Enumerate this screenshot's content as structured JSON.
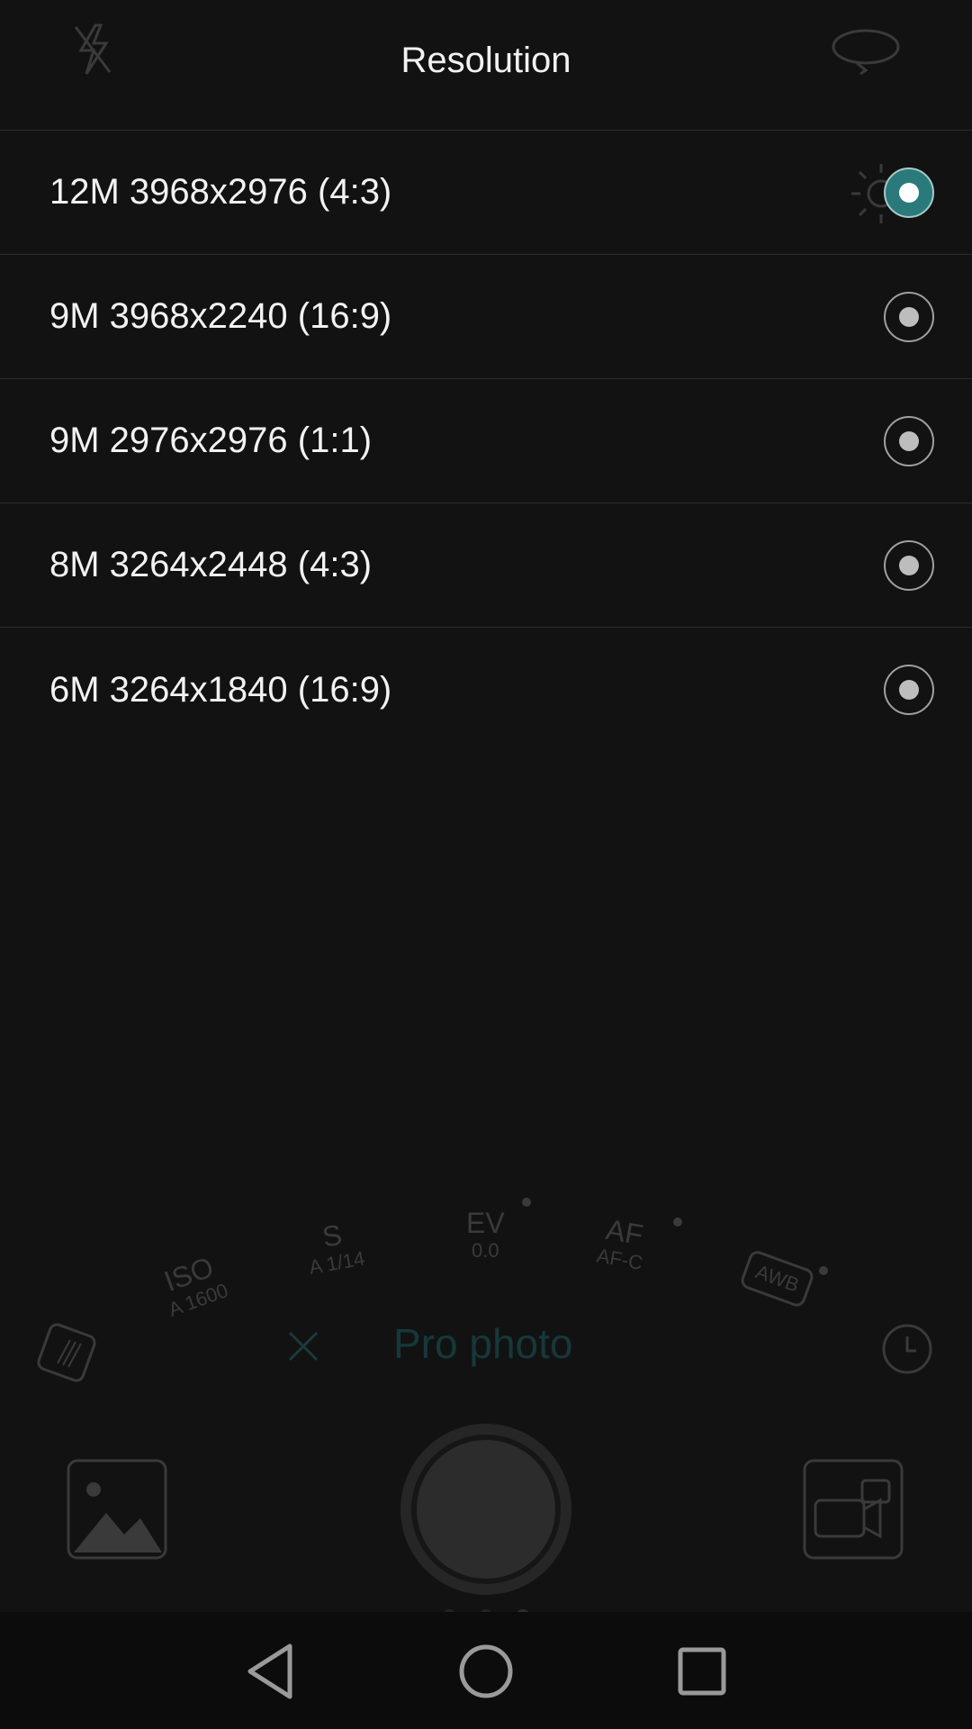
{
  "header": {
    "title": "Resolution"
  },
  "resolutions": [
    {
      "label": "12M 3968x2976 (4:3)",
      "selected": true
    },
    {
      "label": "9M 3968x2240 (16:9)",
      "selected": false
    },
    {
      "label": "9M 2976x2976 (1:1)",
      "selected": false
    },
    {
      "label": "8M 3264x2448 (4:3)",
      "selected": false
    },
    {
      "label": "6M 3264x1840 (16:9)",
      "selected": false
    }
  ],
  "camera": {
    "mode_label": "Pro photo",
    "dials": {
      "iso": {
        "name": "ISO",
        "value": "A 1600"
      },
      "shutter": {
        "name": "S",
        "value": "A 1/14"
      },
      "ev": {
        "name": "EV",
        "value": "0.0"
      },
      "af": {
        "name": "AF",
        "value": "AF-C"
      },
      "awb": {
        "name": "AWB"
      }
    }
  },
  "colors": {
    "accent": "#2a7a7c",
    "background": "#121212"
  },
  "icons": [
    "flash-off-icon",
    "switch-camera-icon",
    "brightness-icon",
    "metering-icon",
    "close-icon",
    "timer-icon",
    "gallery-icon",
    "shutter-button",
    "video-icon",
    "back-icon",
    "home-icon",
    "recents-icon"
  ]
}
